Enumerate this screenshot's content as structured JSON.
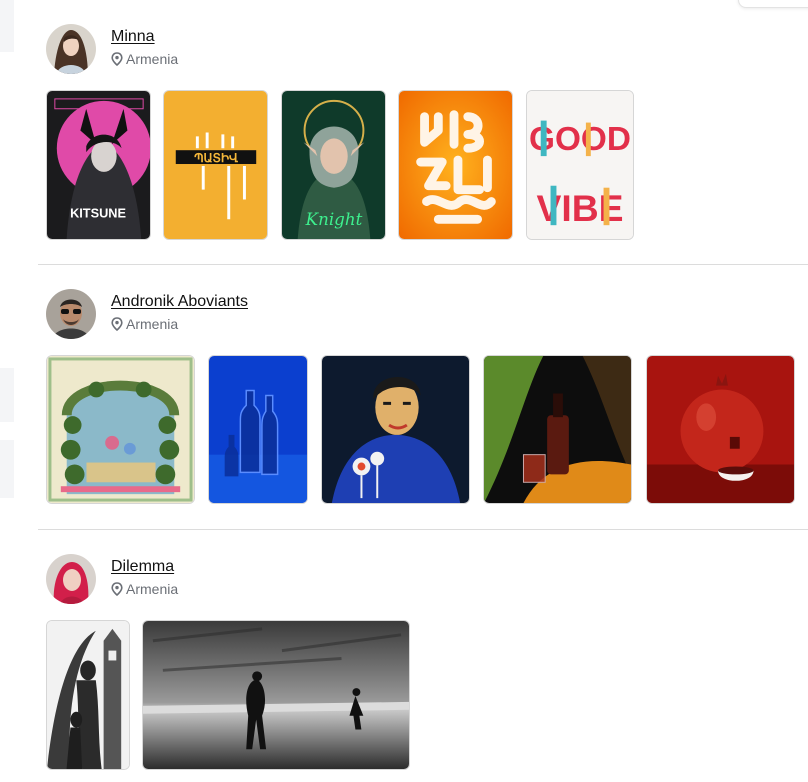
{
  "artists": [
    {
      "name": "Minna",
      "location": "Armenia",
      "artworks": [
        {
          "icon": "kitsune-art",
          "caption": "KITSUNE"
        },
        {
          "icon": "armenian-letters-art",
          "caption": "ՊԱՏԻՎ"
        },
        {
          "icon": "knight-art",
          "caption": "Knight"
        },
        {
          "icon": "cream-letters-art"
        },
        {
          "icon": "good-vibe-art",
          "caption_top": "GOOD",
          "caption_bottom": "VIBE"
        }
      ]
    },
    {
      "name": "Andronik Aboviants",
      "location": "Armenia",
      "artworks": [
        {
          "icon": "garden-art"
        },
        {
          "icon": "bottles-art"
        },
        {
          "icon": "portrait-art"
        },
        {
          "icon": "wine-glass-art"
        },
        {
          "icon": "pomegranate-art"
        }
      ]
    },
    {
      "name": "Dilemma",
      "location": "Armenia",
      "artworks": [
        {
          "icon": "charcoal-figures-art"
        },
        {
          "icon": "charcoal-beach-art"
        }
      ]
    }
  ]
}
